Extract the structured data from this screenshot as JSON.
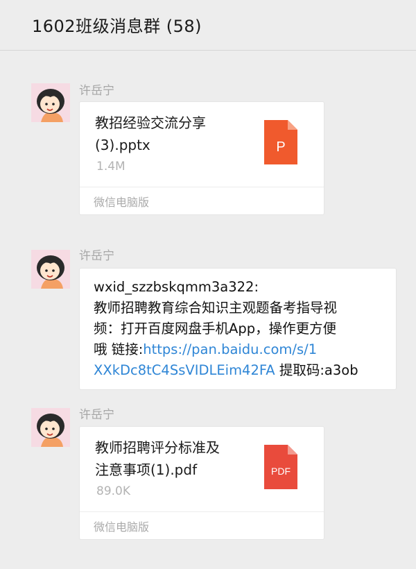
{
  "header": {
    "title": "1602班级消息群 (58)"
  },
  "messages": [
    {
      "sender": "许岳宁",
      "file_name_line1": "教招经验交流分享",
      "file_name_line2": "(3).pptx",
      "file_size": "1.4M",
      "icon_label": "P",
      "icon_color": "#f05a2d",
      "footer": "微信电脑版"
    },
    {
      "sender": "许岳宁",
      "text_line1": "wxid_szzbskqmm3a322:",
      "text_line2": "教师招聘教育综合知识主观题备考指导视",
      "text_line3": "频：打开百度网盘手机App，操作更方便",
      "text_line4_prefix": "哦 链接:",
      "link_part1": "https://pan.baidu.com/s/1",
      "link_part2": "XXkDc8tC4SsVIDLEim42FA",
      "text_suffix": " 提取码:a3ob",
      "link_color": "#2f86d6"
    },
    {
      "sender": "许岳宁",
      "file_name_line1": "教师招聘评分标准及",
      "file_name_line2": "注意事项(1).pdf",
      "file_size": "89.0K",
      "icon_label": "PDF",
      "icon_color": "#e94b3c",
      "footer": "微信电脑版"
    }
  ]
}
